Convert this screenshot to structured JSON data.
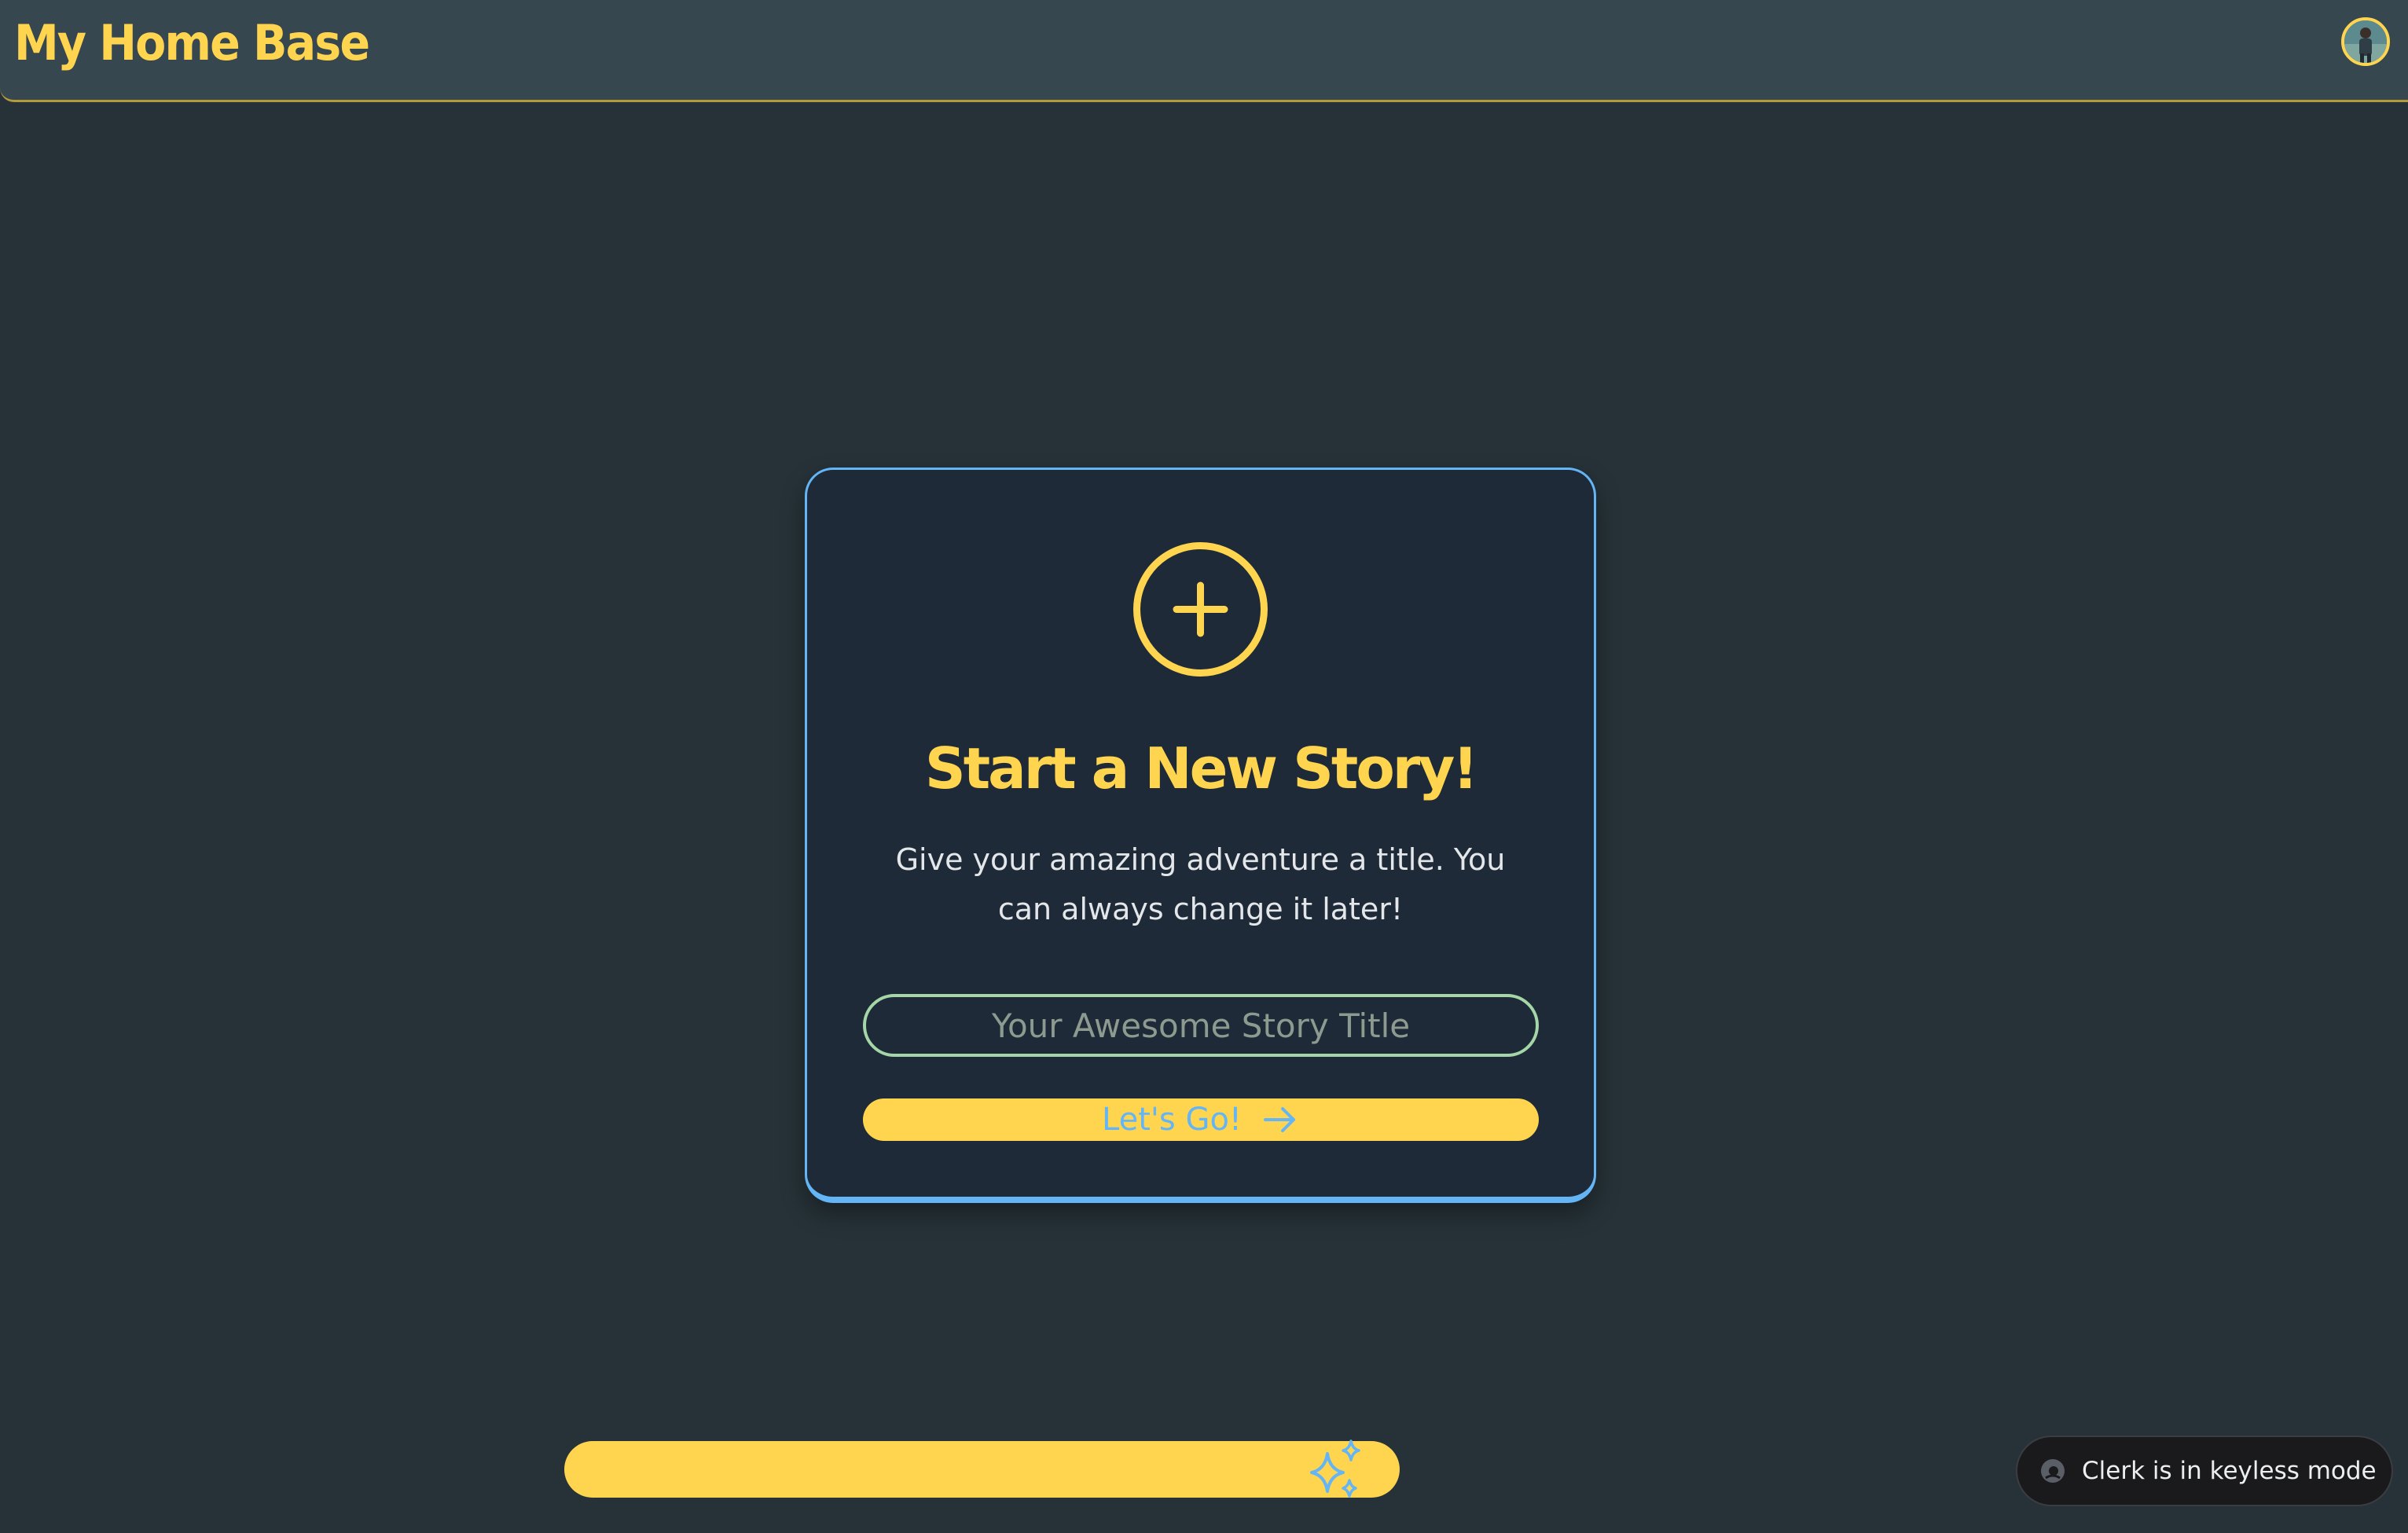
{
  "header": {
    "app_title": "My Home Base",
    "avatar_alt": "User avatar"
  },
  "card": {
    "icon": "plus-circle-icon",
    "title": "Start a New Story!",
    "subtitle": "Give your amazing adventure a title. You can always change it later!",
    "input_placeholder": "Your Awesome Story Title",
    "input_value": "",
    "button_label": "Let's Go!",
    "button_icon": "arrow-right-icon"
  },
  "bottom_bar": {
    "icon": "sparkles-icon"
  },
  "clerk_badge": {
    "icon": "clerk-logo-icon",
    "text": "Clerk is in keyless mode"
  },
  "colors": {
    "background": "#263238",
    "header": "#37474f",
    "card": "#1e2a38",
    "accent_yellow": "#ffd54f",
    "accent_blue": "#64b5f6",
    "input_border": "#a5d6a7"
  }
}
